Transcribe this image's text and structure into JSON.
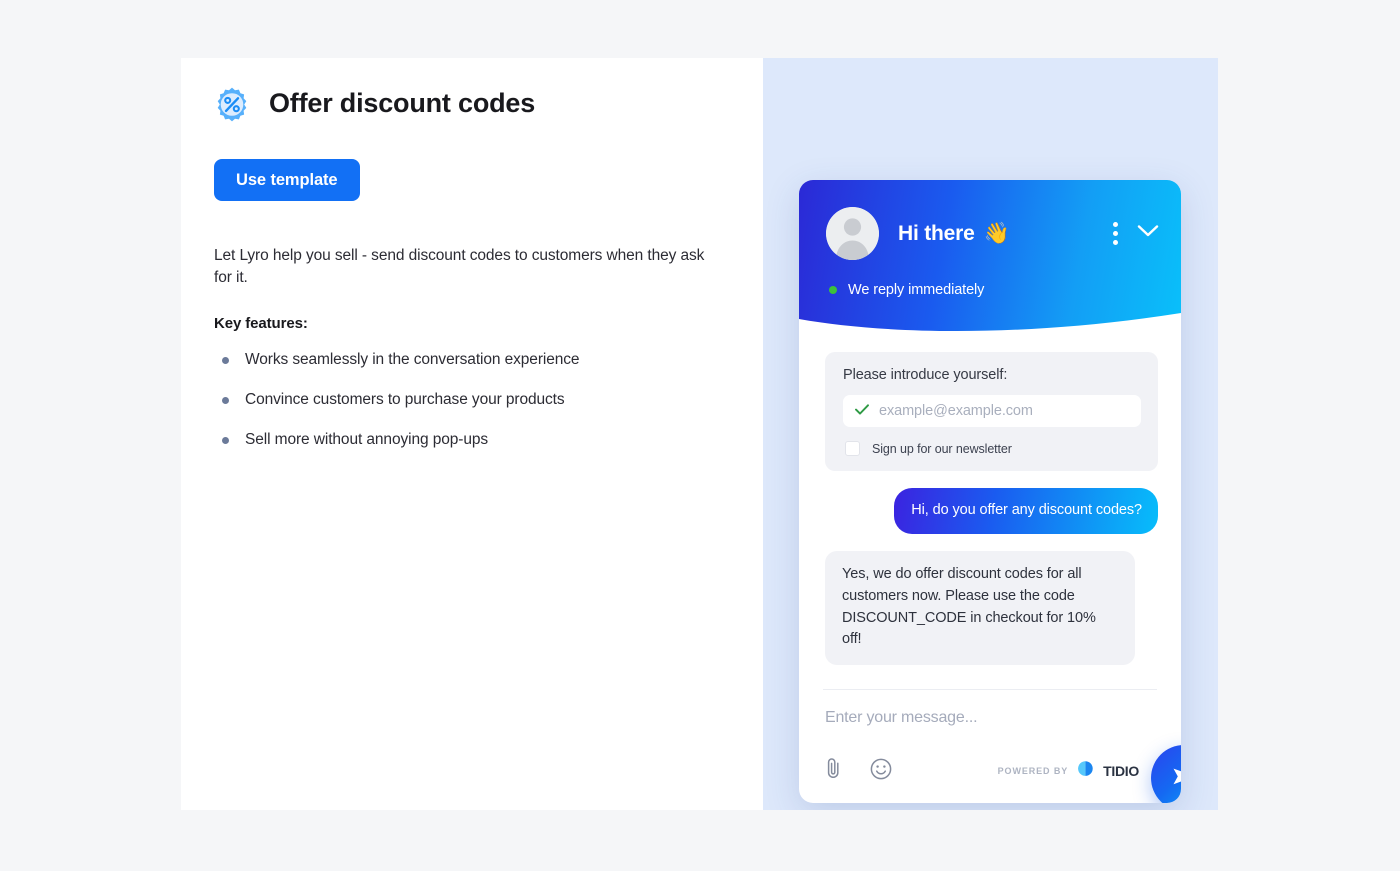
{
  "left": {
    "icon_name": "discount-badge-icon",
    "title": "Offer discount codes",
    "use_template_label": "Use template",
    "intro_text": "Let Lyro help you sell - send discount codes to customers when they ask for it.",
    "key_features_heading": "Key features:",
    "features": [
      "Works seamlessly in the conversation experience",
      "Convince customers to purchase your products",
      "Sell more without annoying pop-ups"
    ]
  },
  "chat": {
    "header": {
      "agent_name": "Hi there",
      "wave_emoji": "👋",
      "menu_icon": "more-vertical-icon",
      "collapse_icon": "chevron-down-icon",
      "status_text": "We reply immediately",
      "status_color": "#3cc13b"
    },
    "prechat": {
      "label": "Please introduce yourself:",
      "email_placeholder": "example@example.com",
      "email_value": "",
      "valid_icon": "check-icon",
      "newsletter_label": "Sign up for our newsletter",
      "newsletter_checked": false
    },
    "messages": [
      {
        "author": "user",
        "text": "Hi, do you offer any discount codes?"
      },
      {
        "author": "bot",
        "text": "Yes, we do offer discount codes for all customers now. Please use the code DISCOUNT_CODE in checkout for 10% off!"
      }
    ],
    "footer": {
      "message_placeholder": "Enter your message...",
      "attach_icon": "paperclip-icon",
      "emoji_icon": "smiley-icon",
      "powered_by_label": "POWERED BY",
      "brand_name": "TIDIO",
      "send_icon": "send-plane-icon"
    }
  },
  "colors": {
    "accent_blue": "#1270f5",
    "gradient_start": "#2b29d6",
    "gradient_end": "#09c0fa",
    "page_background": "#f5f6f8",
    "right_panel": "#dde8fb"
  }
}
